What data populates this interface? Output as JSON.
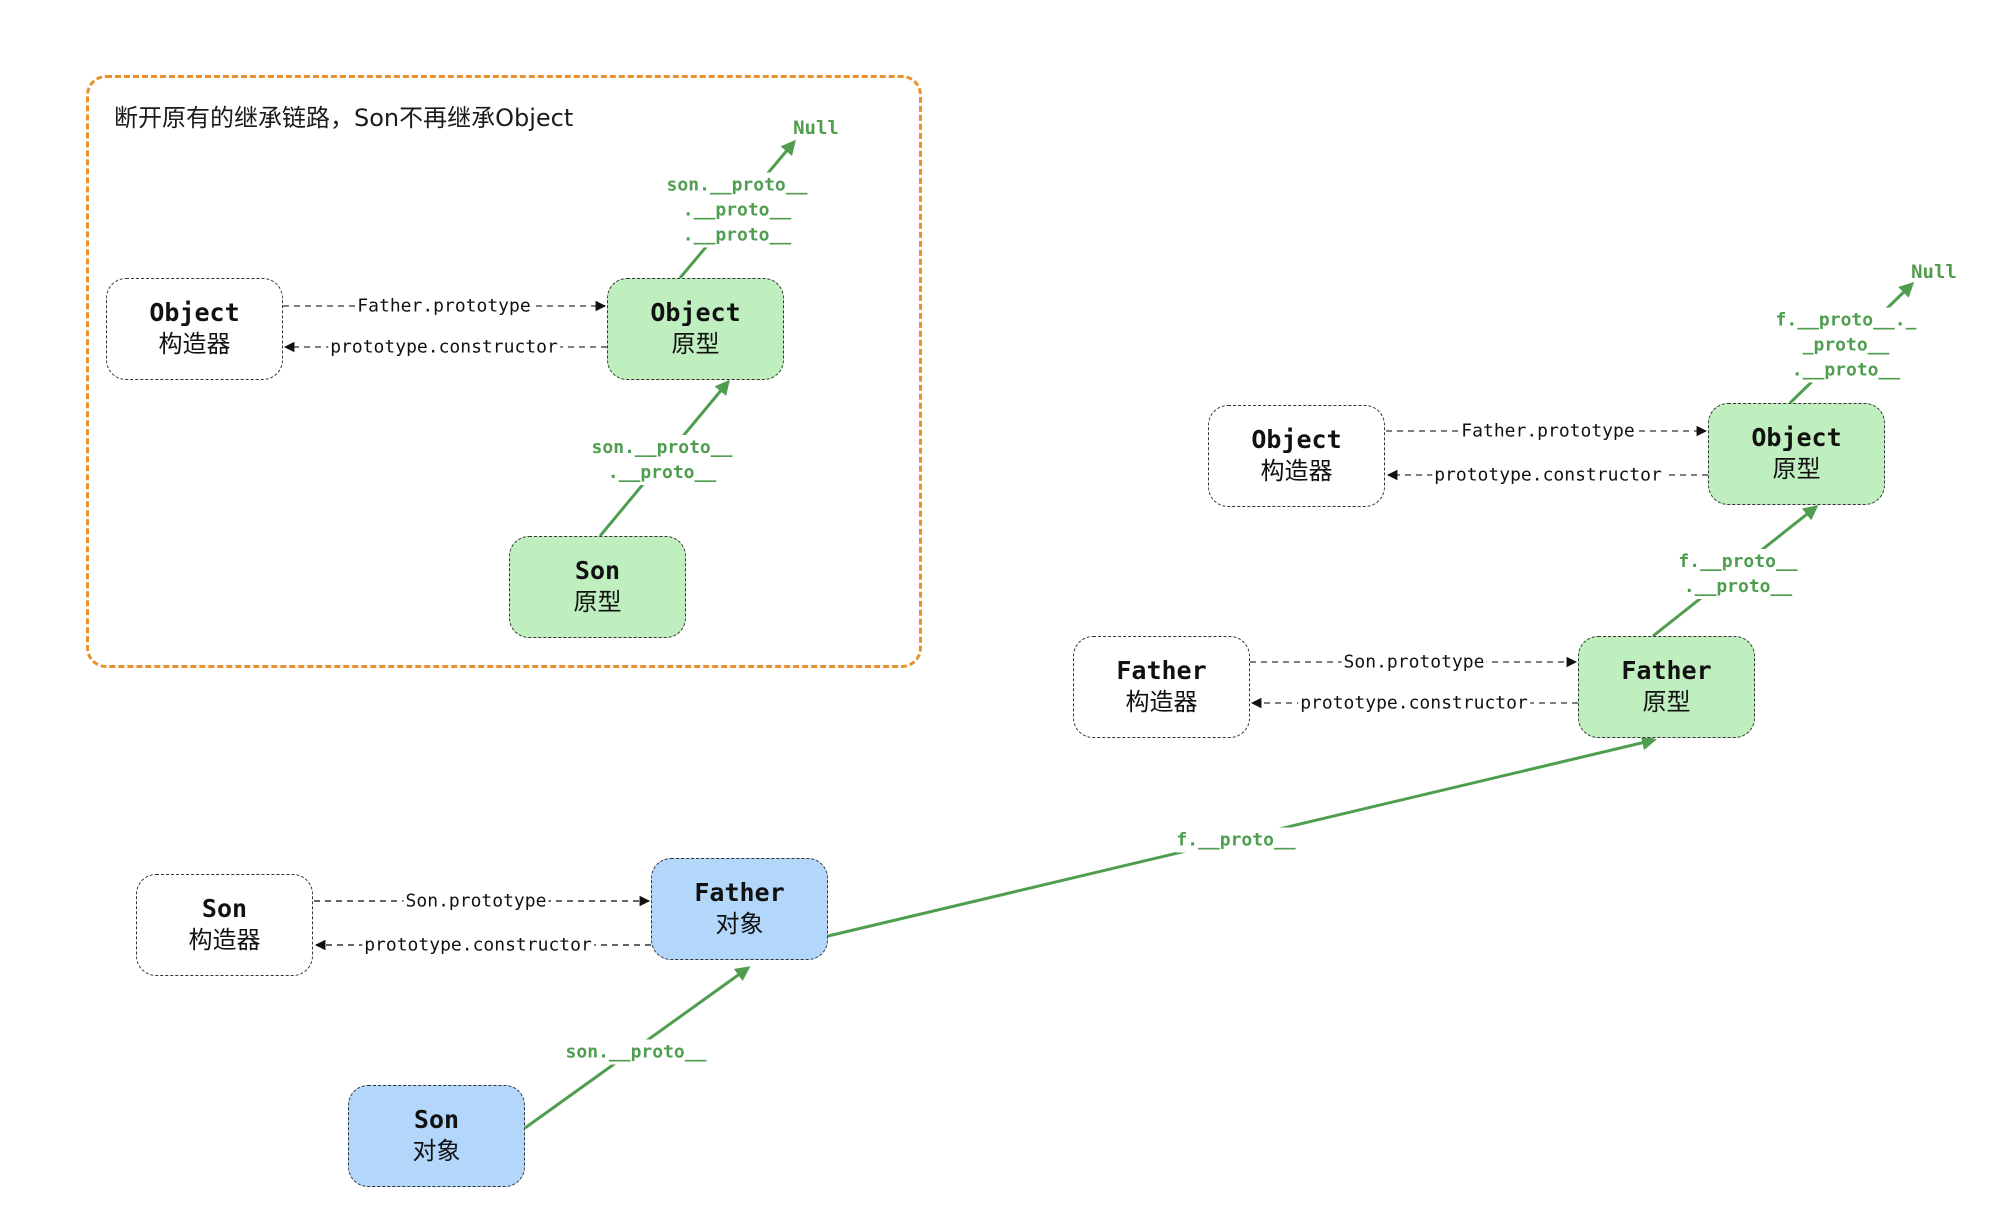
{
  "group": {
    "title": "断开原有的继承链路，Son不再继承Object"
  },
  "nodes": {
    "left_object_ctor": {
      "name": "Object",
      "kind": "构造器"
    },
    "left_object_proto": {
      "name": "Object",
      "kind": "原型"
    },
    "left_son_proto": {
      "name": "Son",
      "kind": "原型"
    },
    "right_object_ctor": {
      "name": "Object",
      "kind": "构造器"
    },
    "right_object_proto": {
      "name": "Object",
      "kind": "原型"
    },
    "father_ctor": {
      "name": "Father",
      "kind": "构造器"
    },
    "father_proto": {
      "name": "Father",
      "kind": "原型"
    },
    "son_ctor": {
      "name": "Son",
      "kind": "构造器"
    },
    "father_object": {
      "name": "Father",
      "kind": "对象"
    },
    "son_object": {
      "name": "Son",
      "kind": "对象"
    }
  },
  "edges": {
    "left_prototype": "Father.prototype",
    "left_constructor": "prototype.constructor",
    "left_son_to_object": "son.__proto__\n.__proto__",
    "left_object_to_null": "son.__proto__\n.__proto__\n.__proto__",
    "left_null": "Null",
    "right_prototype": "Father.prototype",
    "right_constructor": "prototype.constructor",
    "father_prototype": "Son.prototype",
    "father_constructor": "prototype.constructor",
    "father_to_object": "f.__proto__\n.__proto__",
    "object_to_null": "f.__proto__._\n_proto__\n.__proto__",
    "right_null": "Null",
    "son_prototype": "Son.prototype",
    "son_constructor": "prototype.constructor",
    "son_obj_to_father_obj": "son.__proto__",
    "father_obj_to_father_proto": "f.__proto__"
  },
  "colors": {
    "prototype_fill": "#bfeebf",
    "object_fill": "#b3d7fa",
    "proto_chain": "#4f9e4f",
    "group_border": "#e8912d"
  }
}
